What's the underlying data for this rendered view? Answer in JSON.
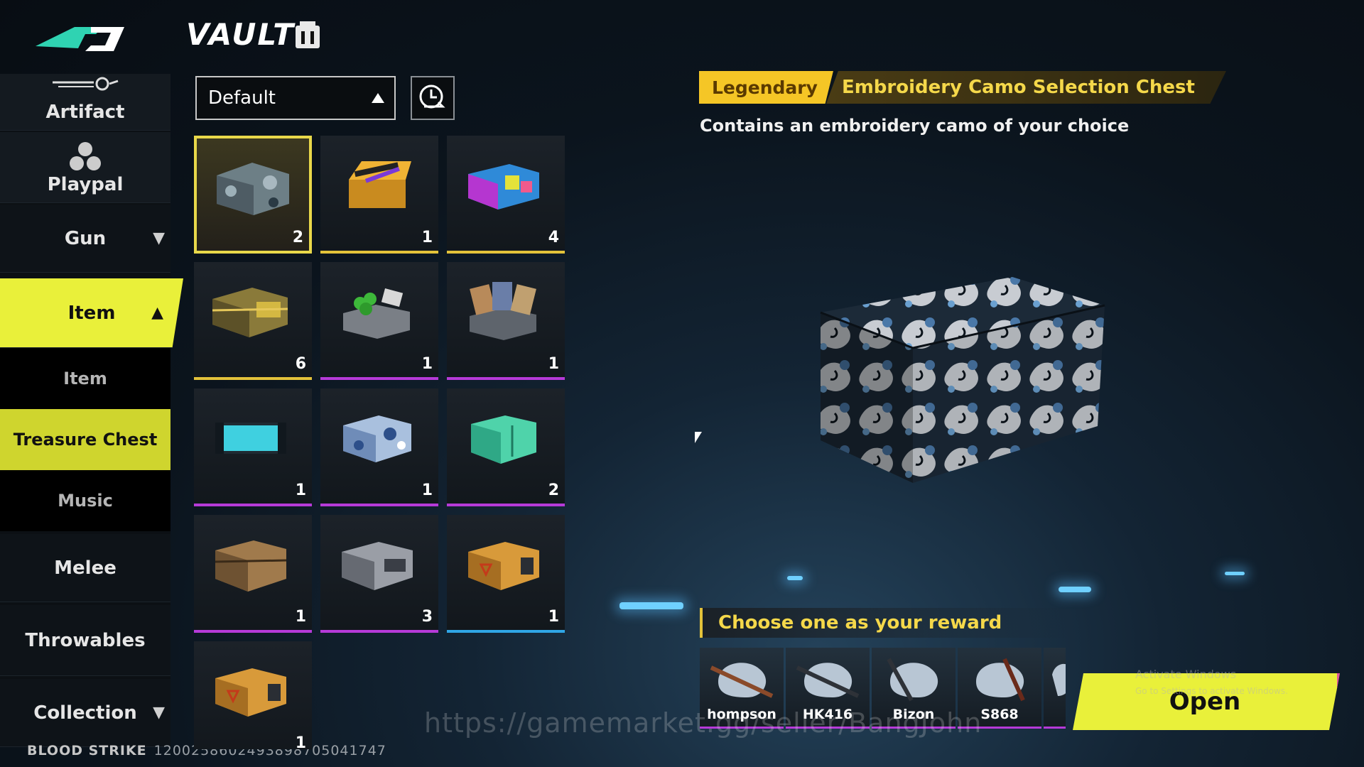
{
  "header": {
    "title": "VAULT",
    "logo_icon": "blood-strike-logo-icon",
    "vault_icon": "vault-box-icon"
  },
  "sidebar": {
    "items": [
      {
        "label": "Artifact",
        "icon": "artifact-icon"
      },
      {
        "label": "Playpal",
        "icon": "playpal-icon"
      },
      {
        "label": "Gun",
        "icon": "chevron-down-icon"
      },
      {
        "label": "Item",
        "icon": "chevron-up-icon"
      },
      {
        "label": "Melee"
      },
      {
        "label": "Throwables"
      },
      {
        "label": "Collection",
        "icon": "chevron-down-icon"
      }
    ],
    "subitems": [
      {
        "label": "Item"
      },
      {
        "label": "Treasure Chest"
      },
      {
        "label": "Music"
      }
    ],
    "active_color": "#e9f03a"
  },
  "footer": {
    "game": "BLOOD STRIKE",
    "player_id": "1200258602493898705041747"
  },
  "filter": {
    "sort_value": "Default",
    "history_icon": "history-clock-icon"
  },
  "grid": {
    "items": [
      {
        "qty": "2",
        "rarity": "legendary",
        "icon": "camo-chest-icon"
      },
      {
        "qty": "1",
        "rarity": "legendary",
        "icon": "weapon-crate-icon"
      },
      {
        "qty": "4",
        "rarity": "legendary",
        "icon": "neon-chest-icon"
      },
      {
        "qty": "6",
        "rarity": "legendary",
        "icon": "gold-chest-icon"
      },
      {
        "qty": "1",
        "rarity": "epic",
        "icon": "clover-chest-icon"
      },
      {
        "qty": "1",
        "rarity": "epic",
        "icon": "card-chest-icon"
      },
      {
        "qty": "1",
        "rarity": "epic",
        "icon": "cyan-chest-icon"
      },
      {
        "qty": "1",
        "rarity": "epic",
        "icon": "blue-camo-chest-icon"
      },
      {
        "qty": "2",
        "rarity": "epic",
        "icon": "teal-chest-icon"
      },
      {
        "qty": "1",
        "rarity": "epic",
        "icon": "bronze-chest-icon"
      },
      {
        "qty": "3",
        "rarity": "epic",
        "icon": "silver-chest-icon"
      },
      {
        "qty": "1",
        "rarity": "rare",
        "icon": "orange-chest-icon"
      },
      {
        "qty": "1",
        "rarity": "rare",
        "icon": "orange-chest-icon"
      }
    ],
    "colors": {
      "legendary": "#e3c23a",
      "epic": "#b63ad8",
      "rare": "#2fa6e6"
    }
  },
  "detail": {
    "rarity": "Legendary",
    "name": "Embroidery Camo Selection Chest",
    "description": "Contains an embroidery camo of your choice",
    "reward_title": "Choose one as your reward",
    "rewards": [
      {
        "label": "hompson"
      },
      {
        "label": "HK416"
      },
      {
        "label": "Bizon"
      },
      {
        "label": "S868"
      }
    ],
    "open_button": "Open",
    "rarity_color": "#f5c626"
  },
  "overlay": {
    "activate_title": "Activate Windows",
    "activate_sub": "Go to Settings to activate Windows.",
    "watermark": "https://gamemarket.gg/seller/BangJohn"
  }
}
